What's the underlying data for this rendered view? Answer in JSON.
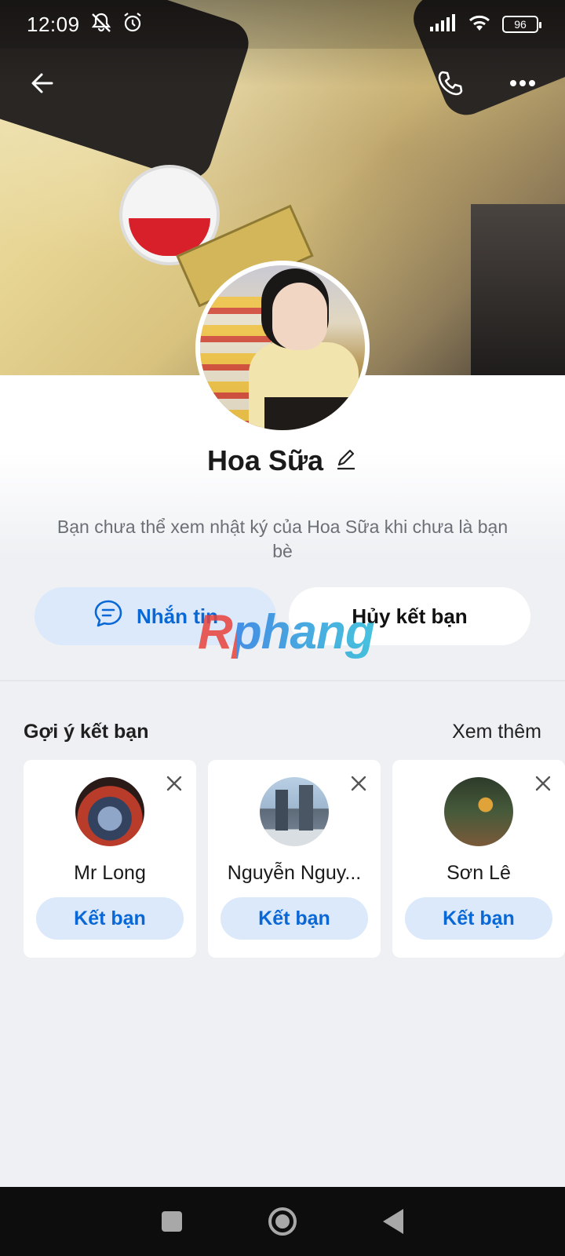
{
  "status_bar": {
    "time": "12:09",
    "battery": "96",
    "icons": [
      "mute-icon",
      "alarm-icon",
      "signal-icon",
      "wifi-icon",
      "battery-icon"
    ]
  },
  "nav": {
    "icons": [
      "back-arrow-icon",
      "phone-icon",
      "more-icon"
    ]
  },
  "profile": {
    "name": "Hoa Sữa",
    "notice": "Bạn chưa thể xem nhật ký của Hoa Sữa khi chưa là bạn bè"
  },
  "actions": {
    "message_label": "Nhắn tin",
    "unfriend_label": "Hủy kết bạn"
  },
  "watermark": "Rphang",
  "suggestions": {
    "title": "Gợi ý kết bạn",
    "see_more": "Xem thêm",
    "items": [
      {
        "name": "Mr Long",
        "button": "Kết bạn"
      },
      {
        "name": "Nguyễn Nguy...",
        "button": "Kết bạn"
      },
      {
        "name": "Sơn Lê",
        "button": "Kết bạn"
      }
    ]
  },
  "colors": {
    "accent": "#0a68d6",
    "accent_bg": "#dbe9fb",
    "page_bg": "#eef0f3"
  }
}
